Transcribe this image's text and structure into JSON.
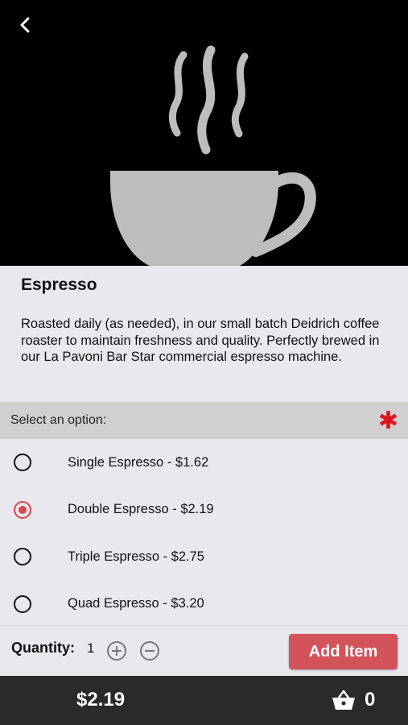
{
  "header": {
    "back_icon": "chevron-left-icon",
    "hero_icon": "coffee-cup-steam-icon"
  },
  "product": {
    "title": "Espresso",
    "description": "Roasted daily (as needed), in our small batch Deidrich coffee roaster to maintain freshness and quality. Perfectly brewed in our La Pavoni Bar Star commercial espresso machine."
  },
  "options": {
    "header_label": "Select an option:",
    "required_marker": "✱",
    "required_color": "#e0141c",
    "items": [
      {
        "label": "Single Espresso - $1.62",
        "selected": false
      },
      {
        "label": "Double Espresso - $2.19",
        "selected": true
      },
      {
        "label": "Triple Espresso - $2.75",
        "selected": false
      },
      {
        "label": "Quad Espresso - $3.20",
        "selected": false
      }
    ]
  },
  "quantity": {
    "label": "Quantity:",
    "value": "1",
    "increment_icon": "plus-circle-icon",
    "decrement_icon": "minus-circle-icon"
  },
  "add_button": {
    "label": "Add Item",
    "color": "#d2535a"
  },
  "footer": {
    "total": "$2.19",
    "cart_icon": "basket-icon",
    "cart_count": "0"
  }
}
